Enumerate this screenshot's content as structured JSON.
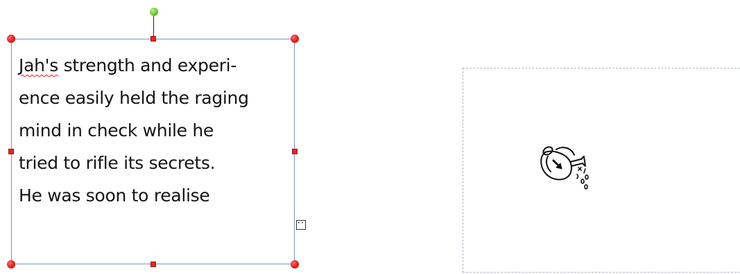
{
  "textbox": {
    "lines": [
      {
        "pre": "",
        "spell": "Jah's",
        "post": " strength and experi-"
      },
      {
        "pre": "ence easily held the raging",
        "spell": "",
        "post": ""
      },
      {
        "pre": "mind in check while he",
        "spell": "",
        "post": ""
      },
      {
        "pre": "tried to rifle its secrets.",
        "spell": "",
        "post": ""
      },
      {
        "pre": "He was soon to realise",
        "spell": "",
        "post": ""
      }
    ],
    "overflow_indicator": "···"
  },
  "placeholder": {
    "image_icon": "watering-can-clipart-icon"
  },
  "colors": {
    "selection_border": "#7a93b8",
    "corner_handle": "#e41e1e",
    "rotate_handle": "#6cc733",
    "spell_underline": "#d91a1a",
    "placeholder_border": "#a9b5c4"
  }
}
